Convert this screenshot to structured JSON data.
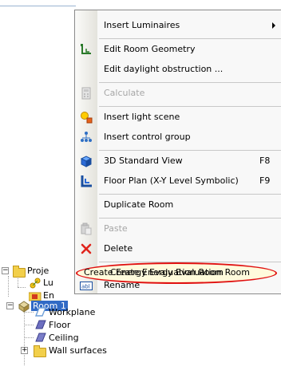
{
  "menu": {
    "items": [
      {
        "label": "Insert Luminaires",
        "shortcut": "",
        "submenu": true,
        "icon": "none",
        "disabled": false
      },
      {
        "label": "Edit Room Geometry",
        "shortcut": "",
        "icon": "room-geometry-icon",
        "disabled": false
      },
      {
        "label": "Edit daylight obstruction ...",
        "shortcut": "",
        "icon": "none",
        "disabled": false
      },
      {
        "label": "Calculate",
        "shortcut": "",
        "icon": "calculator-icon",
        "disabled": true
      },
      {
        "label": "Insert light scene",
        "shortcut": "",
        "icon": "light-scene-icon",
        "disabled": false
      },
      {
        "label": "Insert control group",
        "shortcut": "",
        "icon": "control-group-icon",
        "disabled": false
      },
      {
        "label": "3D Standard View",
        "shortcut": "F8",
        "icon": "3d-view-icon",
        "disabled": false
      },
      {
        "label": "Floor Plan (X-Y Level Symbolic)",
        "shortcut": "F9",
        "icon": "floor-plan-icon",
        "disabled": false
      },
      {
        "label": "Duplicate Room",
        "shortcut": "",
        "icon": "none",
        "disabled": false
      },
      {
        "label": "Paste",
        "shortcut": "",
        "icon": "paste-icon",
        "disabled": true
      },
      {
        "label": "Delete",
        "shortcut": "",
        "icon": "delete-icon",
        "disabled": false
      },
      {
        "label": "Create Energy Evaluation Room",
        "shortcut": "",
        "icon": "none",
        "disabled": false,
        "highlighted": true
      },
      {
        "label": "Rename",
        "shortcut": "",
        "icon": "rename-icon",
        "disabled": false
      }
    ]
  },
  "tree": {
    "project": "Proje",
    "luminaires": "Lu",
    "energy": "En",
    "room": "Room 1",
    "workplane": "Workplane",
    "floor": "Floor",
    "ceiling": "Ceiling",
    "wall_surfaces": "Wall surfaces",
    "collapse_symbol": "−",
    "expand_symbol": "+"
  },
  "colors": {
    "highlight_ring": "#e01010",
    "selection": "#316ac5"
  }
}
